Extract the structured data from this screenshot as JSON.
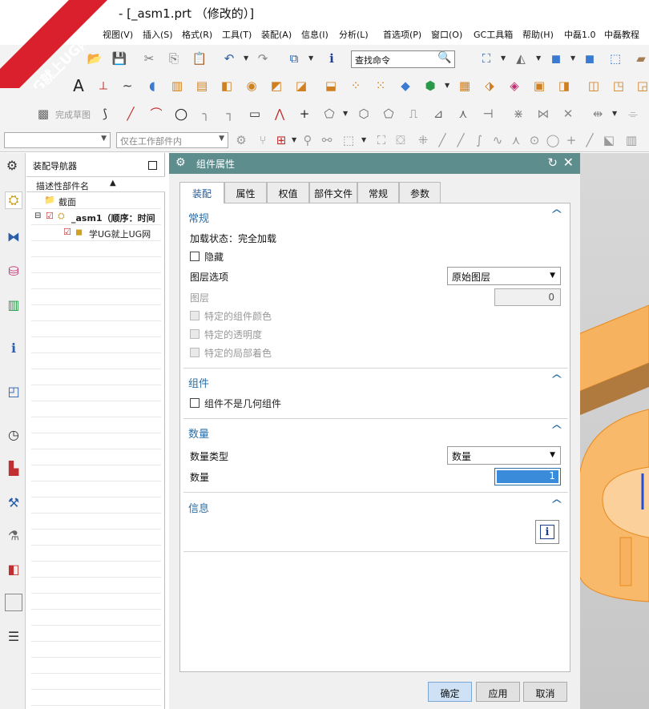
{
  "window": {
    "title": "- [_asm1.prt （修改的）]"
  },
  "watermark": {
    "line1": "9SUG",
    "line2": "学UG就上UG网",
    "color": "#d9202c"
  },
  "menu": {
    "items": [
      "视图(V)",
      "插入(S)",
      "格式(R)",
      "工具(T)",
      "装配(A)",
      "信息(I)",
      "分析(L)",
      "首选项(P)",
      "窗口(O)",
      "GC工具箱",
      "帮助(H)",
      "中磊1.0",
      "中磊教程"
    ]
  },
  "toolbar": {
    "search_placeholder": "查找命令",
    "finish_sketch_label": "完成草图",
    "filter_combo_value": "",
    "scope_combo_value": "仅在工作部件内"
  },
  "navigator": {
    "title": "装配导航器",
    "column_header": "描述性部件名",
    "rows": [
      {
        "label": "截面",
        "bold": false
      },
      {
        "label": "_asm1（顺序：时间",
        "bold": true
      },
      {
        "label": "学UG就上UG网",
        "bold": false
      }
    ]
  },
  "dialog": {
    "title": "组件属性",
    "tabs": [
      "装配",
      "属性",
      "权值",
      "部件文件",
      "常规",
      "参数"
    ],
    "active_tab": "装配",
    "sections": {
      "general": {
        "header": "常规",
        "load_status": "加载状态：完全加载",
        "hide_label": "隐藏",
        "layer_option_label": "图层选项",
        "layer_option_value": "原始图层",
        "layer_label": "图层",
        "layer_value": "0",
        "specific_color_label": "特定的组件颜色",
        "specific_transparency_label": "特定的透明度",
        "specific_shading_label": "特定的局部着色"
      },
      "component": {
        "header": "组件",
        "non_geometry_label": "组件不是几何组件"
      },
      "quantity": {
        "header": "数量",
        "type_label": "数量类型",
        "type_value": "数量",
        "quantity_label": "数量",
        "quantity_value": "1"
      },
      "info": {
        "header": "信息"
      }
    },
    "buttons": {
      "ok": "确定",
      "apply": "应用",
      "cancel": "取消"
    }
  },
  "colors": {
    "dialog_title_bg": "#5e8d8d",
    "section_header": "#2a6fa8",
    "model_orange": "#f5a623"
  }
}
